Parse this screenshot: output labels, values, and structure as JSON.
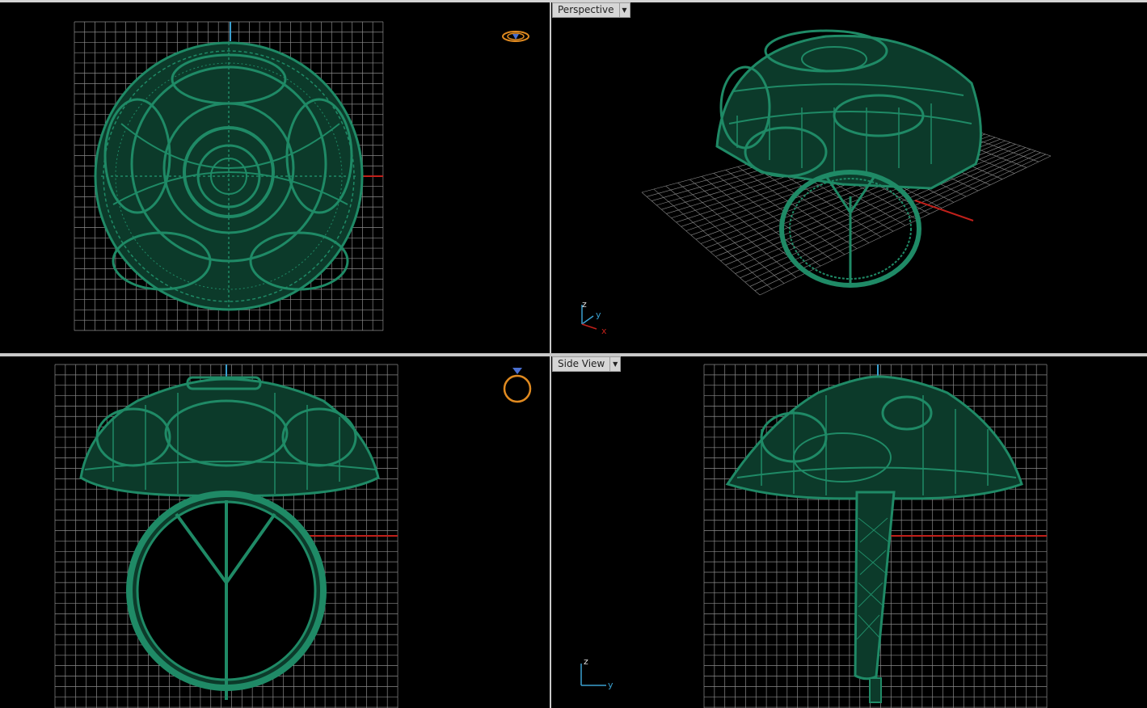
{
  "viewports": {
    "top": {
      "label": ""
    },
    "perspective": {
      "label": "Perspective",
      "axes": {
        "z": "z",
        "y": "y",
        "x": "x"
      }
    },
    "front": {
      "label": ""
    },
    "side": {
      "label": "Side View",
      "axes": {
        "z": "z",
        "y": "y"
      }
    }
  },
  "colors": {
    "background": "#000000",
    "grid": "#8a8a8a",
    "model": "#1f8a66",
    "x_axis": "#c0201a",
    "z_axis": "#3aa0d0",
    "gizmo": "#e08a20"
  },
  "icons": {
    "top_gizmo": "ring-top-gizmo-icon",
    "front_gizmo": "ring-front-gizmo-icon",
    "dropdown": "chevron-down-icon"
  }
}
